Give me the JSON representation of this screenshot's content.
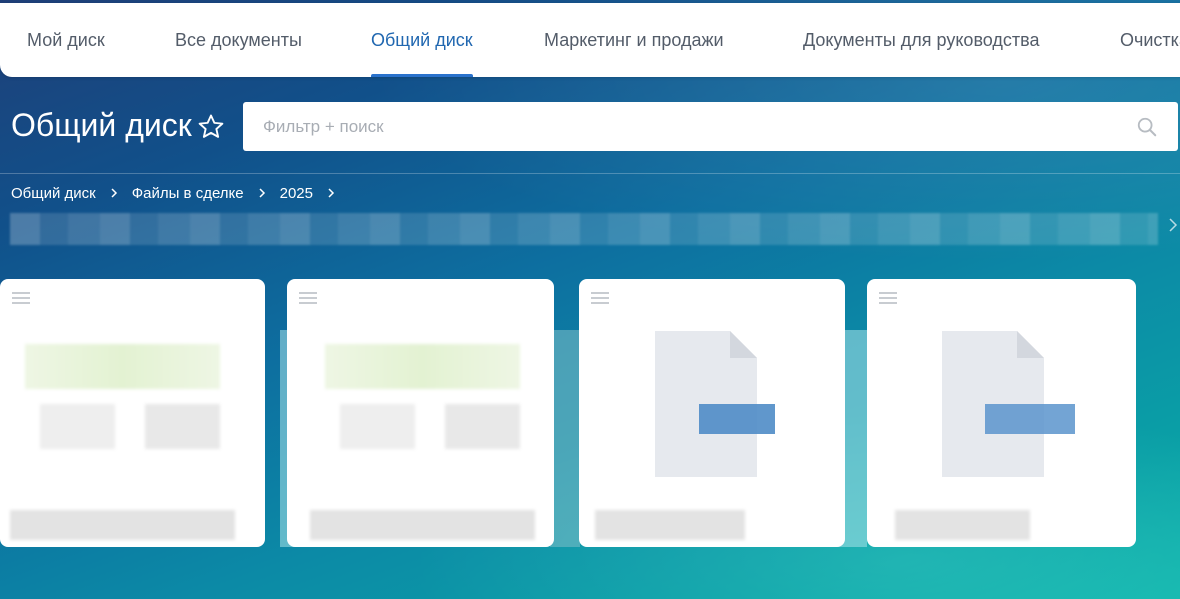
{
  "tabs": [
    {
      "label": "Мой диск"
    },
    {
      "label": "Все документы"
    },
    {
      "label": "Общий диск",
      "active": true
    },
    {
      "label": "Маркетинг и продажи"
    },
    {
      "label": "Документы для руководства"
    },
    {
      "label": "Очистка"
    }
  ],
  "page": {
    "title": "Общий диск",
    "star_icon": "star-icon"
  },
  "search": {
    "placeholder": "Фильтр + поиск",
    "icon": "search-icon"
  },
  "breadcrumb": [
    "Общий диск",
    "Файлы в сделке",
    "2025"
  ],
  "cards": [
    {
      "type": "spreadsheet-preview",
      "menu_icon": "menu-icon"
    },
    {
      "type": "spreadsheet-preview",
      "menu_icon": "menu-icon"
    },
    {
      "type": "document-icon",
      "menu_icon": "menu-icon"
    },
    {
      "type": "document-icon",
      "menu_icon": "menu-icon"
    }
  ],
  "colors": {
    "accent": "#2067b0",
    "tab_text": "#535c69",
    "white": "#ffffff"
  }
}
